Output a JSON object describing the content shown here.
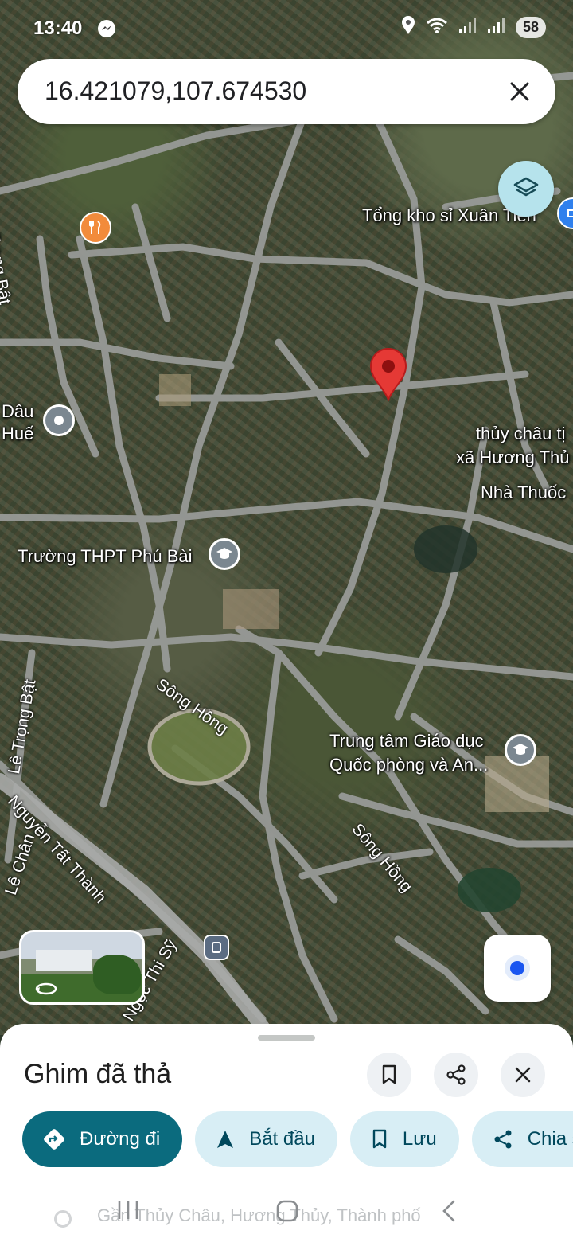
{
  "status_bar": {
    "time": "13:40",
    "battery": "58"
  },
  "search": {
    "query": "16.421079,107.674530"
  },
  "map": {
    "labels": {
      "tong_kho": "Tổng kho sỉ Xuân Tiến",
      "dau": "Dâu",
      "hue": "Huế",
      "thuy_chau_1": "thủy châu tị",
      "thuy_chau_2": "xã Hương Thủ",
      "nha_thuoc": "Nhà Thuốc",
      "truong_thpt": "Trường THPT Phú Bài",
      "trung_tam_1": "Trung tâm Giáo dục",
      "trung_tam_2": "Quốc phòng và An...",
      "le_trong_bat_top": "Trọng Bật",
      "le_trong_bat": "Lê Trọng Bật",
      "song_hong_1": "Sông Hồng",
      "song_hong_2": "Sông Hồng",
      "nguyen_tat_thanh": "Nguyễn Tất Thành",
      "le_chan": "Lê Chân",
      "ngoc_thi": "Ngọc Thi Sỹ"
    }
  },
  "sheet": {
    "title": "Ghim đã thả",
    "actions": [
      {
        "label": "Đường đi",
        "icon": "directions-icon"
      },
      {
        "label": "Bắt đầu",
        "icon": "navigation-arrow-icon"
      },
      {
        "label": "Lưu",
        "icon": "bookmark-icon"
      },
      {
        "label": "Chia sẻ",
        "icon": "share-icon"
      }
    ],
    "address": "Gần Thủy Châu, Hương Thủy, Thành phố"
  },
  "colors": {
    "primary": "#0b6b7e",
    "chip": "#d8eef5",
    "pin": "#e53935",
    "layers": "#b6e3ec"
  }
}
